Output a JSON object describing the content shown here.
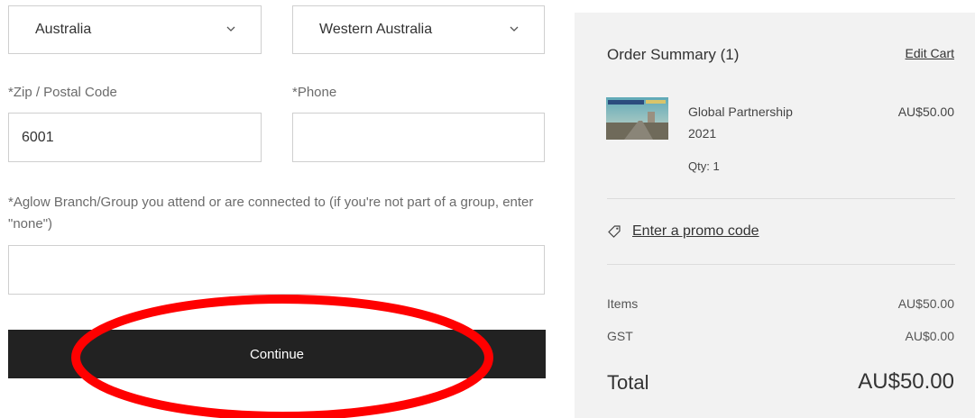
{
  "form": {
    "country": "Australia",
    "state": "Western Australia",
    "zip_label": "*Zip / Postal Code",
    "zip_value": "6001",
    "phone_label": "*Phone",
    "phone_value": "",
    "branch_label": "*Aglow Branch/Group you attend or are connected to (if you're not part of a group, enter \"none\")",
    "branch_value": "",
    "continue_label": "Continue"
  },
  "summary": {
    "title": "Order Summary (1)",
    "edit_cart": "Edit Cart",
    "product": {
      "name": "Global Partnership 2021",
      "price": "AU$50.00",
      "qty": "Qty: 1"
    },
    "promo_link": "Enter a promo code",
    "items_label": "Items",
    "items_value": "AU$50.00",
    "gst_label": "GST",
    "gst_value": "AU$0.00",
    "total_label": "Total",
    "total_value": "AU$50.00"
  },
  "colors": {
    "button_bg": "#222222",
    "summary_bg": "#f2f2f2",
    "annotation": "#ff0000"
  },
  "icons": {
    "chevron": "chevron-down-icon",
    "promo": "tag-icon"
  }
}
